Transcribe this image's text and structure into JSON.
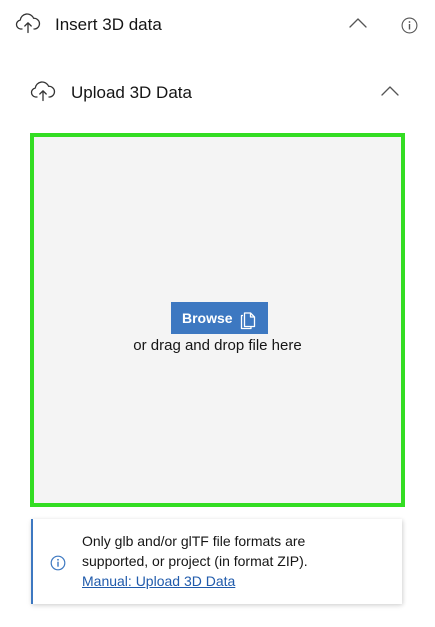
{
  "header": {
    "title": "Insert 3D data",
    "icons": [
      "cloud-upload-icon",
      "chevron-up-icon",
      "info-icon"
    ]
  },
  "section": {
    "title": "Upload 3D Data",
    "icons": [
      "cloud-upload-icon",
      "chevron-up-icon"
    ]
  },
  "dropzone": {
    "browse_label": "Browse",
    "browse_icon": "copy-icon",
    "hint": "or drag and drop file here",
    "border_color": "#33dd22",
    "background": "#f4f4f4"
  },
  "note": {
    "line1": "Only glb and/or glTF file formats are",
    "line2": "supported, or project (in format ZIP).",
    "link": "Manual: Upload 3D Data",
    "icon": "info-icon"
  },
  "colors": {
    "accent": "#3d78c1",
    "link": "#1f5aab",
    "text": "#151515"
  }
}
